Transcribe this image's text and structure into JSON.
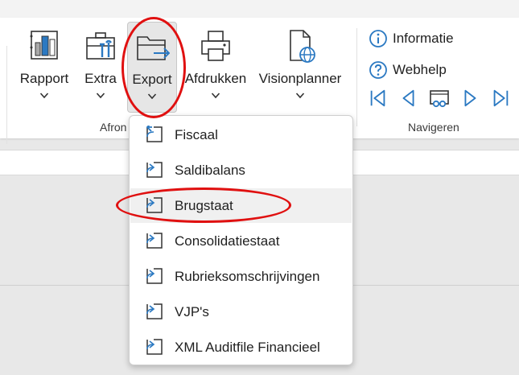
{
  "ribbon": {
    "buttons": [
      {
        "label": "Rapport",
        "icon": "report-chart-icon"
      },
      {
        "label": "Extra",
        "icon": "toolbox-icon"
      },
      {
        "label": "Export",
        "icon": "folder-export-icon"
      },
      {
        "label": "Afdrukken",
        "icon": "printer-icon"
      },
      {
        "label": "Visionplanner",
        "icon": "document-globe-icon"
      }
    ],
    "group_afronden_label": "Afron",
    "info": {
      "informatie_label": "Informatie",
      "webhelp_label": "Webhelp"
    },
    "navigate_group_label": "Navigeren"
  },
  "export_menu": {
    "items": [
      {
        "label": "Fiscaal"
      },
      {
        "label": "Saldibalans"
      },
      {
        "label": "Brugstaat"
      },
      {
        "label": "Consolidatiestaat"
      },
      {
        "label": "Rubrieksomschrijvingen"
      },
      {
        "label": "VJP's"
      },
      {
        "label": "XML Auditfile Financieel"
      }
    ],
    "hovered_item": "Brugstaat"
  },
  "colors": {
    "accent": "#2b79c2",
    "annotation": "#e01010"
  }
}
